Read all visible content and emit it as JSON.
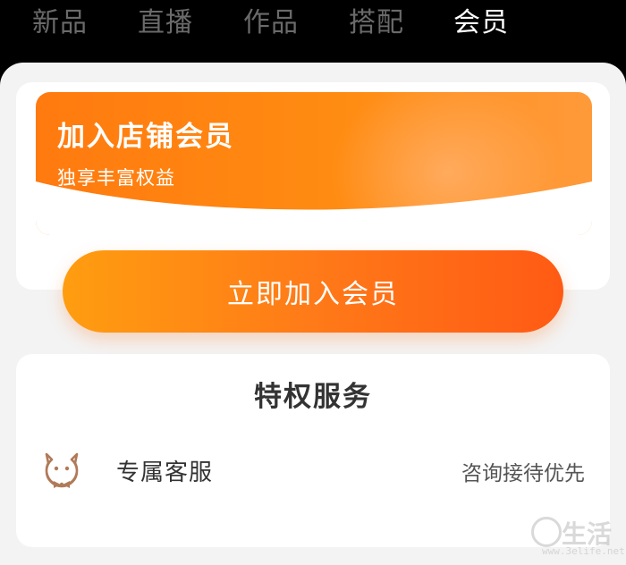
{
  "tabs": [
    {
      "label": "新品",
      "active": false
    },
    {
      "label": "直播",
      "active": false
    },
    {
      "label": "作品",
      "active": false
    },
    {
      "label": "搭配",
      "active": false
    },
    {
      "label": "会员",
      "active": true
    }
  ],
  "banner": {
    "title": "加入店铺会员",
    "subtitle": "独享丰富权益"
  },
  "join_button": {
    "label": "立即加入会员"
  },
  "privilege": {
    "title": "特权服务",
    "items": [
      {
        "icon": "customer-service-icon",
        "name": "专属客服",
        "desc": "咨询接待优先"
      }
    ]
  },
  "watermark": {
    "text": "生活",
    "url": "www.3elife.net"
  },
  "colors": {
    "accent": "#ff7a0f",
    "accent_dark": "#ff5a14",
    "icon_brown": "#b07a58"
  }
}
